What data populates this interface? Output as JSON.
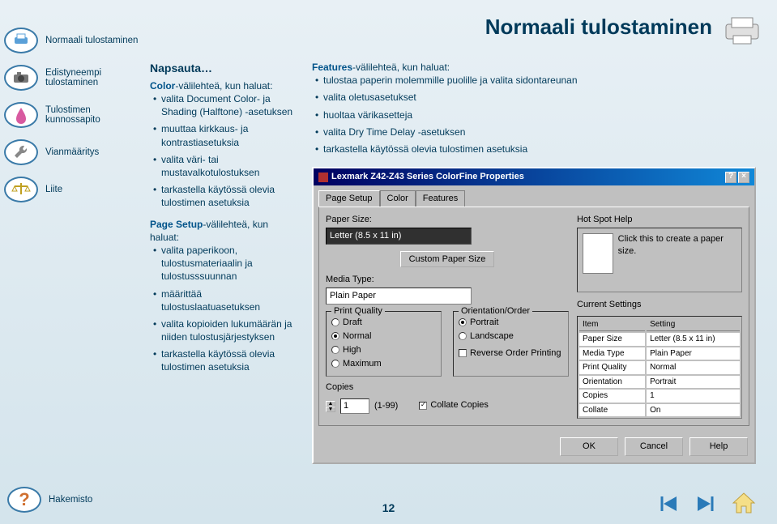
{
  "title": "Normaali tulostaminen",
  "page_number": "12",
  "sidebar": {
    "items": [
      {
        "label": "Normaali tulostaminen",
        "icon": "printer-icon"
      },
      {
        "label": "Edistyneempi tulostaminen",
        "icon": "camera-icon"
      },
      {
        "label": "Tulostimen kunnossapito",
        "icon": "ink-icon"
      },
      {
        "label": "Vianmääritys",
        "icon": "wrench-icon"
      },
      {
        "label": "Liite",
        "icon": "scales-icon"
      }
    ],
    "hakemisto_label": "Hakemisto"
  },
  "left_col": {
    "heading": "Napsauta…",
    "color_heading_prefix": "Color",
    "color_heading_suffix": "-välilehteä, kun haluat:",
    "color_bullets": [
      "valita Document Color- ja Shading (Halftone) -asetuksen",
      "muuttaa kirkkaus- ja kontrastiasetuksia",
      "valita väri- tai mustavalkotulostuksen",
      "tarkastella käytössä olevia tulostimen asetuksia"
    ],
    "page_setup_prefix": "Page Setup",
    "page_setup_suffix": "-välilehteä, kun haluat:",
    "page_setup_bullets": [
      "valita paperikoon, tulostusmateriaalin ja tulostusssuunnan",
      "määrittää tulostuslaatuasetuksen",
      "valita kopioiden lukumäärän ja niiden tulostusjärjestyksen",
      "tarkastella käytössä olevia tulostimen asetuksia"
    ]
  },
  "right_col": {
    "features_prefix": "Features",
    "features_suffix": "-välilehteä, kun haluat:",
    "features_bullets": [
      "tulostaa paperin molemmille puolille ja valita sidontareunan",
      "valita oletusasetukset",
      "huoltaa värikasetteja",
      "valita Dry Time Delay -asetuksen",
      "tarkastella käytössä olevia tulostimen asetuksia"
    ]
  },
  "dialog": {
    "title": "Lexmark Z42-Z43 Series ColorFine Properties",
    "tabs": [
      "Page Setup",
      "Color",
      "Features"
    ],
    "paper_size_label": "Paper Size:",
    "paper_size_value": "Letter (8.5 x 11 in)",
    "custom_paper_btn": "Custom Paper Size",
    "media_type_label": "Media Type:",
    "media_type_value": "Plain Paper",
    "print_quality_label": "Print Quality",
    "quality_options": [
      "Draft",
      "Normal",
      "High",
      "Maximum"
    ],
    "orientation_label": "Orientation/Order",
    "orientation_options": [
      "Portrait",
      "Landscape"
    ],
    "reverse_label": "Reverse Order Printing",
    "copies_label": "Copies",
    "copies_value": "1",
    "copies_range": "(1-99)",
    "collate_label": "Collate Copies",
    "hotspot_label": "Hot Spot Help",
    "hotspot_text": "Click this to create a paper size.",
    "current_settings_label": "Current Settings",
    "settings_headers": [
      "Item",
      "Setting"
    ],
    "settings_rows": [
      [
        "Paper Size",
        "Letter (8.5 x 11 in)"
      ],
      [
        "Media Type",
        "Plain Paper"
      ],
      [
        "Print Quality",
        "Normal"
      ],
      [
        "Orientation",
        "Portrait"
      ],
      [
        "Copies",
        "1"
      ],
      [
        "Collate",
        "On"
      ]
    ],
    "buttons": [
      "OK",
      "Cancel",
      "Help"
    ]
  }
}
